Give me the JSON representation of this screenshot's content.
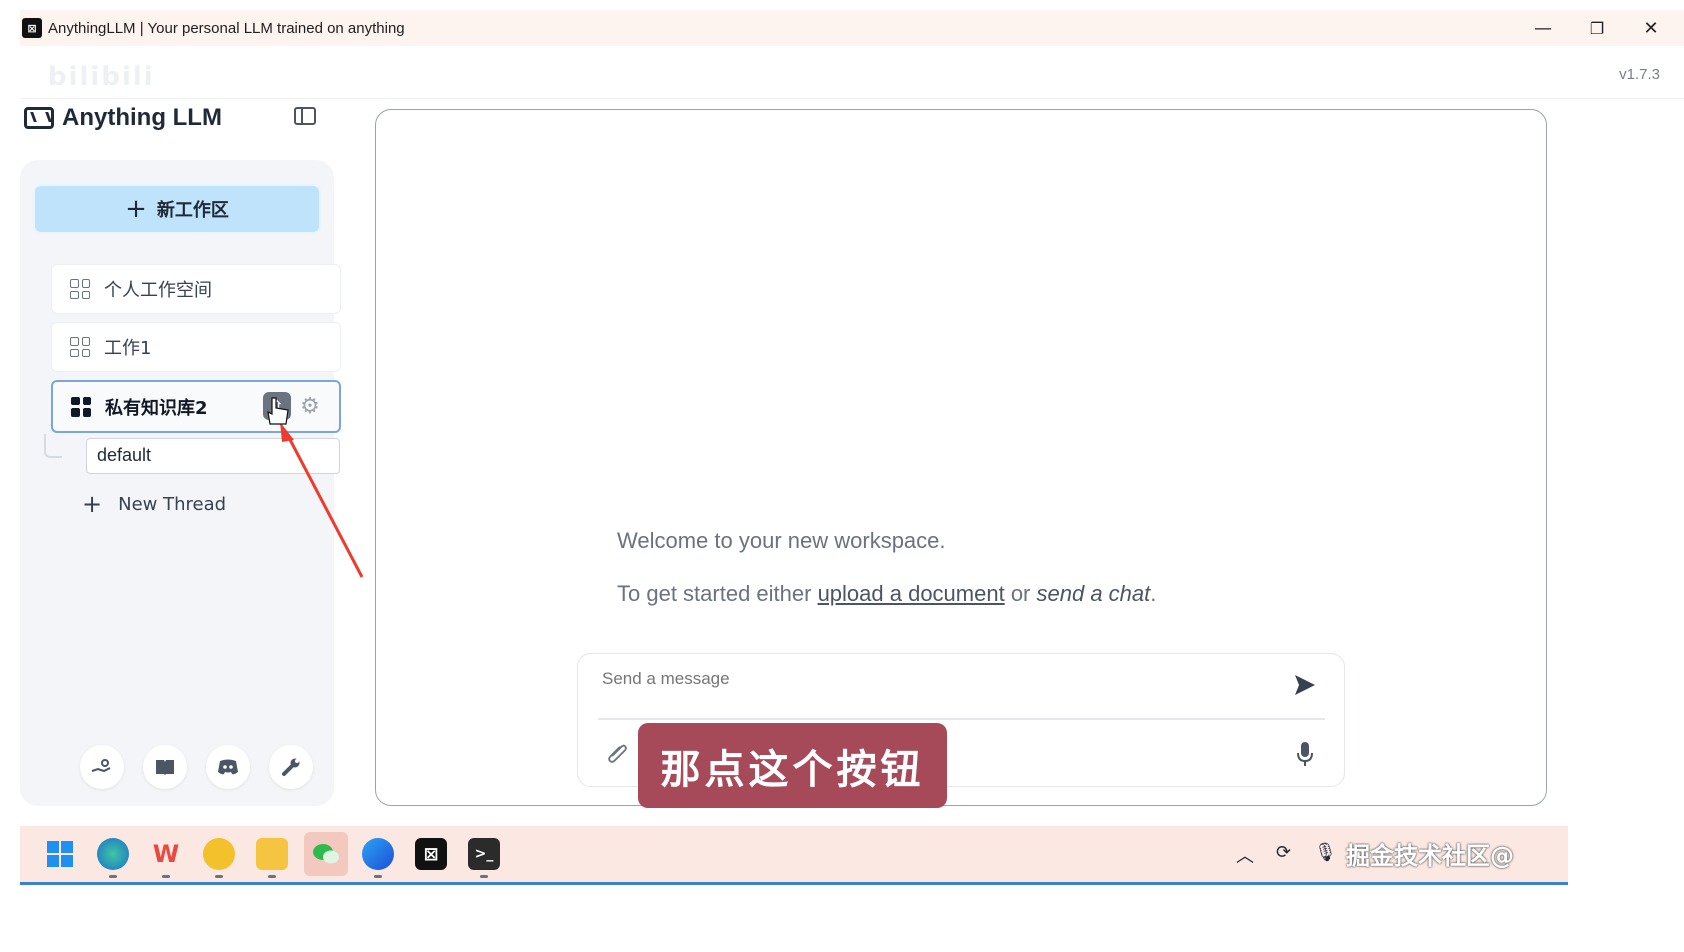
{
  "window": {
    "title": "AnythingLLM | Your personal LLM trained on anything",
    "app_icon_glyph": "⊠",
    "minimize_glyph": "—",
    "maximize_glyph": "❐",
    "close_glyph": "✕",
    "version": "v1.7.3",
    "watermark": "bilibili"
  },
  "sidebar": {
    "brand": "Anything LLM",
    "new_workspace_label": "新工作区",
    "workspaces": [
      {
        "label": "个人工作空间"
      },
      {
        "label": "工作1"
      },
      {
        "label": "私有知识库2",
        "active": true
      }
    ],
    "thread_value": "default",
    "new_thread_label": "New Thread",
    "footer_icons": [
      "community-hub-icon",
      "docs-book-icon",
      "discord-icon",
      "settings-wrench-icon"
    ]
  },
  "main": {
    "welcome": "Welcome to your new workspace.",
    "get_started_prefix": "To get started either ",
    "upload_link": "upload a document",
    "or_text": " or ",
    "send_chat": "send a chat",
    "period": "."
  },
  "composer": {
    "placeholder": "Send a message"
  },
  "caption": "那点这个按钮",
  "taskbar": {
    "tray_text": "掘金技术社区@"
  },
  "colors": {
    "accent_button": "#bfe3fb",
    "active_border": "#7aa6d8",
    "caption_bg": "#a64a5a",
    "annotation_arrow": "#ef3b2d",
    "taskbar_bg": "#fce8e2"
  }
}
